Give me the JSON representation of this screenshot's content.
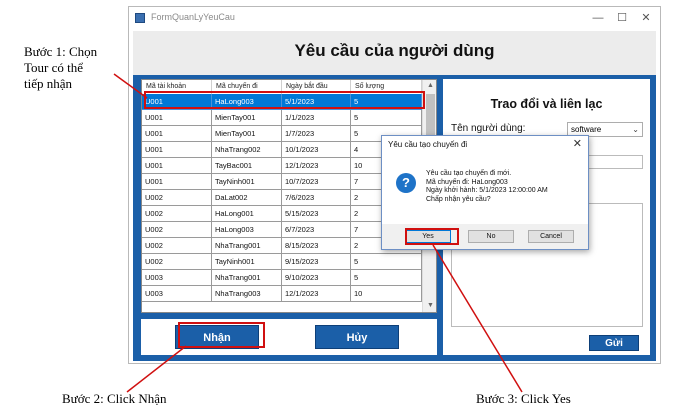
{
  "annotations": {
    "step1": [
      "Bước 1: Chọn",
      "Tour có thể",
      "tiếp nhận"
    ],
    "step2": "Bước 2: Click Nhận",
    "step3": "Bước 3: Click Yes"
  },
  "window": {
    "title": "FormQuanLyYeuCau",
    "form_title": "Yêu cầu của người dùng",
    "minimize": "—",
    "maximize": "☐",
    "close": "✕"
  },
  "grid": {
    "columns": [
      "Mã tài khoản",
      "Mã chuyến đi",
      "Ngày bắt đầu",
      "Số lượng"
    ],
    "rows": [
      [
        "U001",
        "HaLong003",
        "5/1/2023",
        "5"
      ],
      [
        "U001",
        "MienTay001",
        "1/1/2023",
        "5"
      ],
      [
        "U001",
        "MienTay001",
        "1/7/2023",
        "5"
      ],
      [
        "U001",
        "NhaTrang002",
        "10/1/2023",
        "4"
      ],
      [
        "U001",
        "TayBac001",
        "12/1/2023",
        "10"
      ],
      [
        "U001",
        "TayNinh001",
        "10/7/2023",
        "7"
      ],
      [
        "U002",
        "DaLat002",
        "7/6/2023",
        "2"
      ],
      [
        "U002",
        "HaLong001",
        "5/15/2023",
        "2"
      ],
      [
        "U002",
        "HaLong003",
        "6/7/2023",
        "7"
      ],
      [
        "U002",
        "NhaTrang001",
        "8/15/2023",
        "2"
      ],
      [
        "U002",
        "TayNinh001",
        "9/15/2023",
        "5"
      ],
      [
        "U003",
        "NhaTrang001",
        "9/10/2023",
        "5"
      ],
      [
        "U003",
        "NhaTrang003",
        "12/1/2023",
        "10"
      ]
    ],
    "selected_row": 0
  },
  "buttons": {
    "accept": "Nhận",
    "cancel": "Hủy"
  },
  "chat_panel": {
    "title": "Trao đổi và liên lạc",
    "user_label": "Tên người dùng:",
    "user_value": "software",
    "send": "Gửi"
  },
  "dialog": {
    "title": "Yêu cầu tạo chuyến đi",
    "close": "✕",
    "icon": "?",
    "lines": [
      "Yêu cầu tạo chuyến đi mới.",
      "Mã chuyến đi: HaLong003",
      "Ngày khởi hành: 5/1/2023 12:00:00 AM",
      "Chấp nhận yêu cầu?"
    ],
    "yes": "Yes",
    "no": "No",
    "cancel": "Cancel"
  },
  "colors": {
    "accent": "#1b5fa8",
    "selection": "#0078d7",
    "highlight": "#d01010"
  }
}
